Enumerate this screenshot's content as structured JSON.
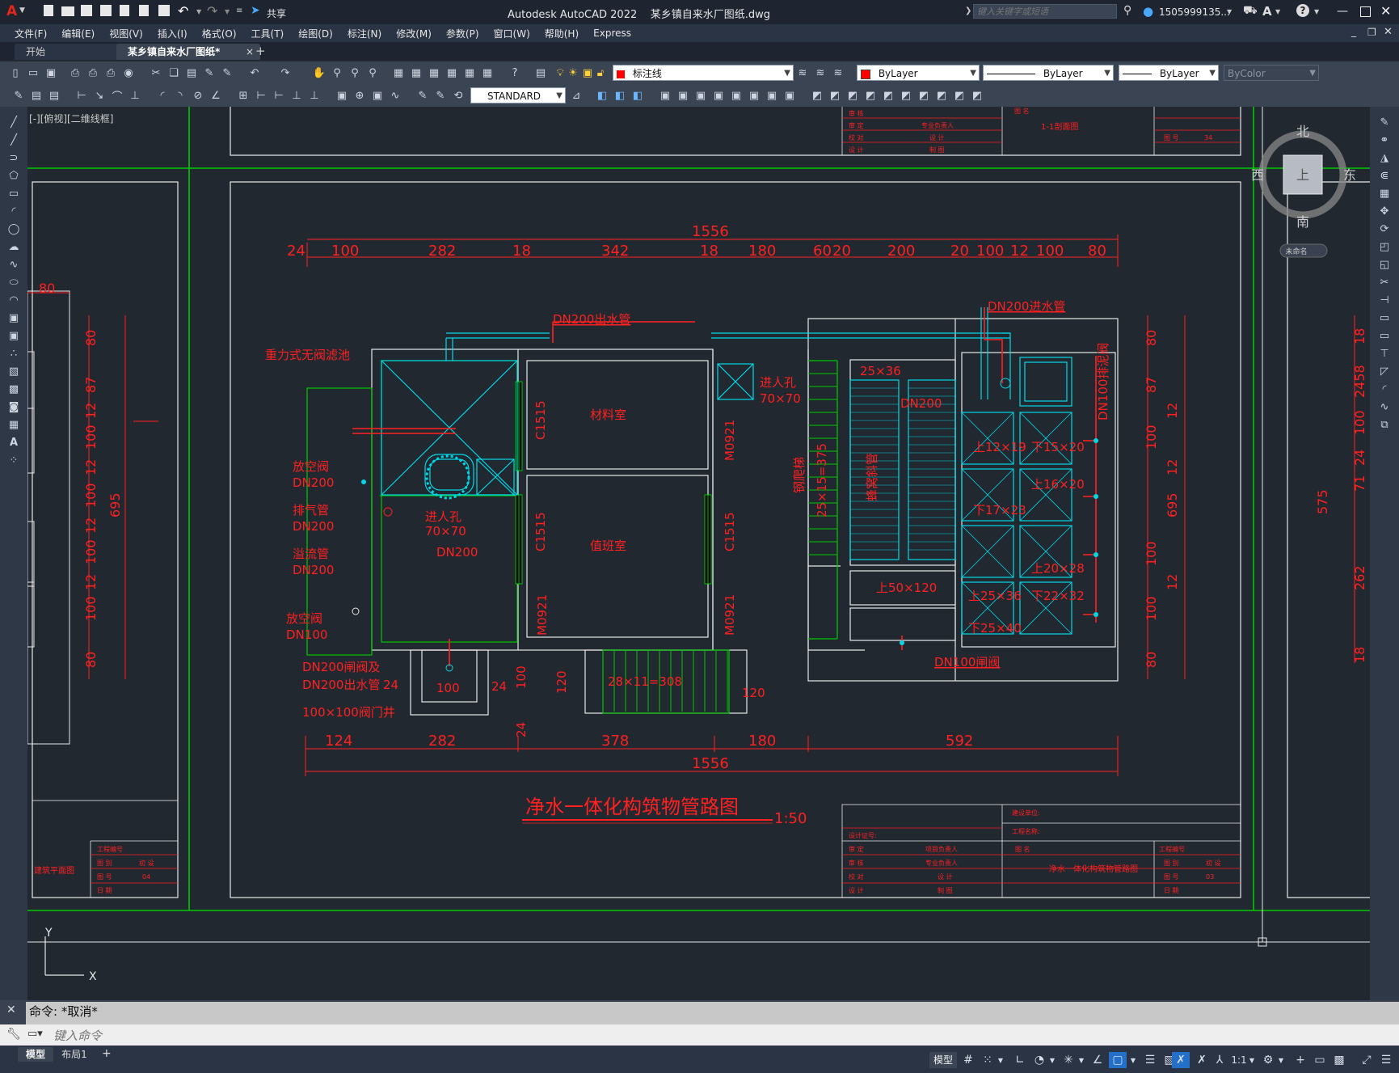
{
  "titlebar": {
    "app_title": "Autodesk AutoCAD 2022",
    "file_name": "某乡镇自来水厂图纸.dwg",
    "share_label": "共享",
    "search_placeholder": "键入关键字或短语",
    "user_name": "1505999135..."
  },
  "menubar": {
    "items": [
      "文件(F)",
      "编辑(E)",
      "视图(V)",
      "插入(I)",
      "格式(O)",
      "工具(T)",
      "绘图(D)",
      "标注(N)",
      "修改(M)",
      "参数(P)",
      "窗口(W)",
      "帮助(H)",
      "Express"
    ]
  },
  "tabs": {
    "start": "开始",
    "active": "某乡镇自来水厂图纸*",
    "close": "×",
    "add": "+"
  },
  "toolbar1": {
    "layer_name": "标注线",
    "color": "ByLayer",
    "linetype": "ByLayer",
    "lineweight": "ByLayer",
    "plotstyle": "ByColor",
    "layer_color": "#ff0000"
  },
  "toolbar2": {
    "text_style": "STANDARD"
  },
  "viewport": {
    "label": "[-][俯视][二维线框]"
  },
  "viewcube": {
    "north": "北",
    "south": "南",
    "east": "东",
    "west": "西",
    "top_face": "上",
    "ucs_label": "未命名"
  },
  "ucs": {
    "y": "Y",
    "x": "X"
  },
  "drawing": {
    "main_title": "净水一体化构筑物管路图",
    "scale": "1:50",
    "dim_top_total": "1556",
    "dim_top_segments": [
      "24",
      "100",
      "282",
      "18",
      "342",
      "18",
      "180",
      "60",
      "20",
      "200",
      "20",
      "100",
      "12",
      "100",
      "80"
    ],
    "dim_bottom_segments": [
      "124",
      "282",
      "378",
      "180",
      "592"
    ],
    "dim_bottom_total": "1556",
    "left_dims": [
      "80",
      "87",
      "12",
      "100",
      "12",
      "100",
      "695",
      "12",
      "100",
      "12",
      "100",
      "80"
    ],
    "right_dims": [
      "80",
      "87",
      "12",
      "100",
      "12",
      "695",
      "100",
      "12",
      "100",
      "80"
    ],
    "far_right_dims": [
      "18",
      "2458",
      "100",
      "24",
      "71",
      "575",
      "262",
      "18"
    ],
    "left_partial_dim": "80",
    "labels": {
      "outlet_pipe": "DN200出水管",
      "inlet_pipe": "DN200进水管",
      "filter_pool": "重力式无阀滤池",
      "vent_valve": "放空阀",
      "vent_valve_size": "DN200",
      "exhaust_pipe": "排气管",
      "exhaust_size": "DN200",
      "overflow_pipe": "溢流管",
      "overflow_size": "DN200",
      "drain_valve": "放空阀",
      "drain_size": "DN100",
      "gate_valve": "DN200闸阀及",
      "gate_valve2": "DN200出水管",
      "valve_well": "100×100阀门井",
      "manhole1": "进人孔",
      "manhole1_size": "70×70",
      "manhole2": "进人孔",
      "manhole2_size": "70×70",
      "dn200_a": "DN200",
      "dn200_b": "DN200",
      "material_room": "材料室",
      "duty_room": "值班室",
      "window1": "C1515",
      "window2": "C1515",
      "window3": "C1515",
      "door1": "M0921",
      "door2": "M0921",
      "door3": "M0921",
      "ladder": "钢爬梯",
      "ladder_dim": "25×15=375",
      "stair_label": "蜂窝斜管",
      "size_25x36": "25×36",
      "mud_valve": "DN100排泥阀",
      "dn100_gate": "DN100闸阀",
      "s50x120": "上50×120",
      "s12x19": "上12×19",
      "s15x20": "下15×20",
      "s16x20": "上16×20",
      "s17x23": "下17×23",
      "s20x28": "上20×28",
      "s25x36": "上25×36",
      "s22x32": "下22×32",
      "s25x40": "下25×40",
      "steps": "28×11=308",
      "dim120a": "120",
      "dim120b": "120",
      "dim100": "100",
      "dim24a": "24",
      "dim24b": "24",
      "dim24c": "24",
      "dim100b": "100"
    },
    "titleblock_top": {
      "rows": [
        "审 核",
        "审 定",
        "校 对",
        "设 计"
      ],
      "mid": [
        "专业负责人",
        "设 计",
        "制 图"
      ],
      "right": [
        "图 名",
        "图 号"
      ],
      "name": "1-1剖面图",
      "num": "34"
    },
    "titleblock_bottom": {
      "client": "建设单位:",
      "project": "工程名称:",
      "cert": "设计证号:",
      "rows": [
        "审 定",
        "审 核",
        "校 对",
        "设 计"
      ],
      "mid": [
        "项目负责人",
        "专业负责人",
        "设 计",
        "制 图"
      ],
      "drawing_name_label": "图 名",
      "drawing_name": "净水一体化构筑物管路图",
      "right": [
        "工程编号",
        "图 别",
        "图 号",
        "日 期"
      ],
      "right_vals": [
        "",
        "初 设",
        "03",
        ""
      ]
    },
    "titleblock_left": {
      "right": [
        "工程编号",
        "图 别",
        "图 号",
        "日 期"
      ],
      "vals": [
        "",
        "初 设",
        "04",
        ""
      ],
      "name": "建筑平面图"
    }
  },
  "command": {
    "history": "命令: *取消*",
    "placeholder": "键入命令"
  },
  "statusbar": {
    "model_tab": "模型",
    "layout_tab": "布局1",
    "add": "+",
    "model_label": "模型",
    "scale": "1:1"
  },
  "colors": {
    "red": "#ff2020",
    "green": "#00c800",
    "cyan": "#00d8e8",
    "white": "#e8e8e8",
    "bg": "#212830"
  }
}
